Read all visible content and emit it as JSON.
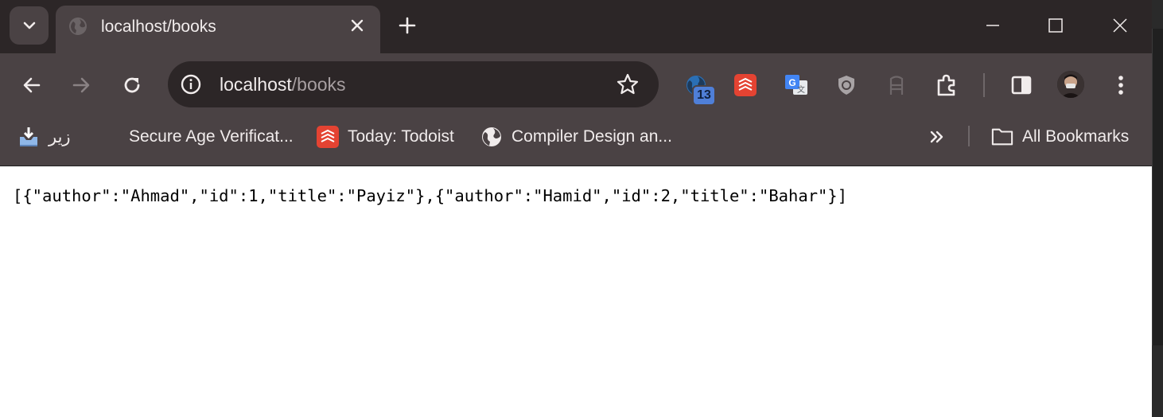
{
  "tab": {
    "title": "localhost/books"
  },
  "omnibox": {
    "host": "localhost",
    "path": "/books"
  },
  "extensions": {
    "badge_count": "13"
  },
  "bookmarks": {
    "items": [
      {
        "label": "زیر",
        "icon": "download-tray-icon"
      },
      {
        "label": "Secure Age Verificat...",
        "icon": ""
      },
      {
        "label": "Today: Todoist",
        "icon": "todoist-icon"
      },
      {
        "label": "Compiler Design an...",
        "icon": "globe-icon"
      }
    ],
    "all_bookmarks": "All Bookmarks"
  },
  "page": {
    "body_text": "[{\"author\":\"Ahmad\",\"id\":1,\"title\":\"Payiz\"},{\"author\":\"Hamid\",\"id\":2,\"title\":\"Bahar\"}]"
  },
  "colors": {
    "frame": "#2c2627",
    "toolbar": "#4a4244",
    "text": "#f1ecec",
    "todoist": "#e44332",
    "badge": "#4f7fd8"
  }
}
